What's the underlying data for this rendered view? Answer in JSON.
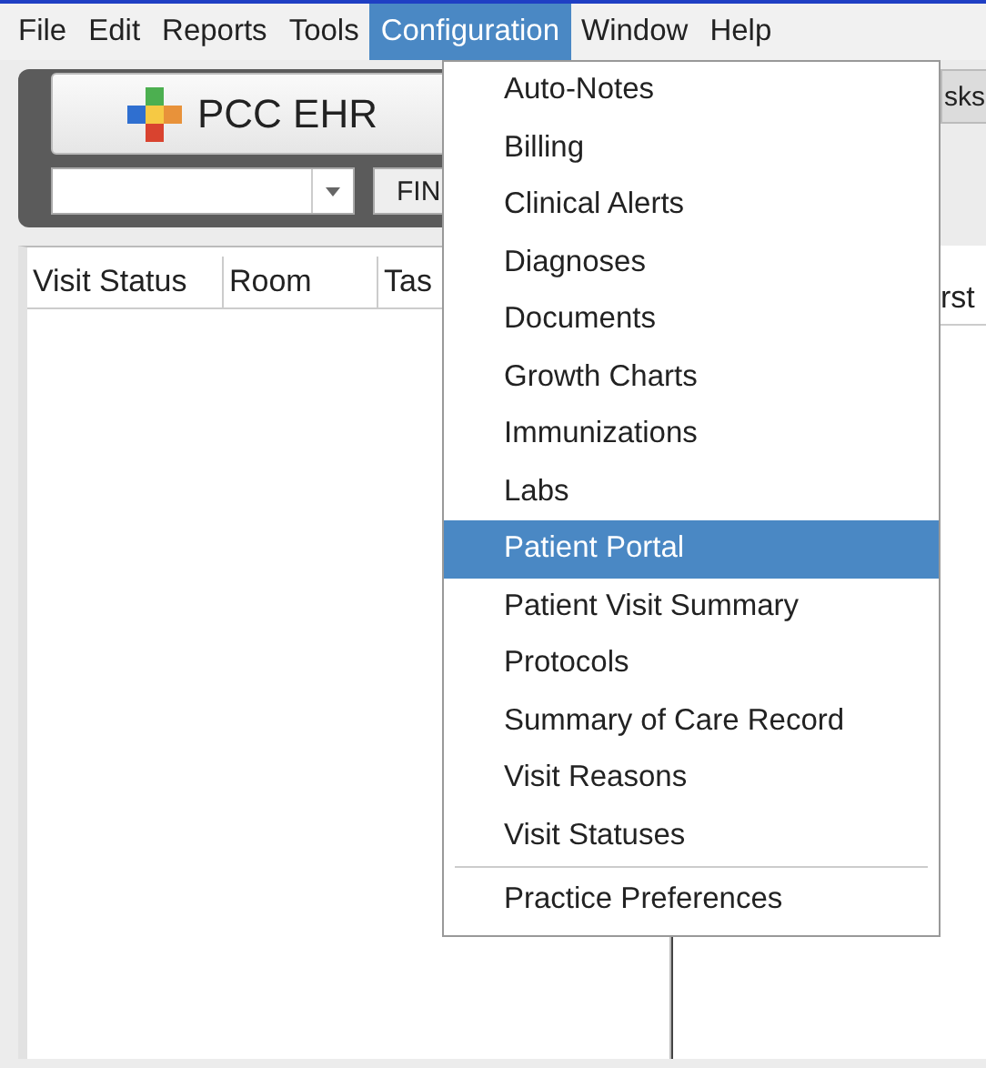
{
  "menu_bar": [
    {
      "label": "File",
      "selected": false
    },
    {
      "label": "Edit",
      "selected": false
    },
    {
      "label": "Reports",
      "selected": false
    },
    {
      "label": "Tools",
      "selected": false
    },
    {
      "label": "Configuration",
      "selected": true
    },
    {
      "label": "Window",
      "selected": false
    },
    {
      "label": "Help",
      "selected": false
    }
  ],
  "toolbar": {
    "app_button": "PCC EHR",
    "find_button": "FIN",
    "tasks_button": "sks"
  },
  "left_table": {
    "columns": [
      "Visit Status",
      "Room",
      "Tas"
    ]
  },
  "right_table": {
    "columns": [
      "rst"
    ]
  },
  "menu": {
    "items": [
      {
        "kind": "item",
        "label": "Auto-Notes",
        "selected": false
      },
      {
        "kind": "item",
        "label": "Billing",
        "selected": false
      },
      {
        "kind": "item",
        "label": "Clinical Alerts",
        "selected": false
      },
      {
        "kind": "item",
        "label": "Diagnoses",
        "selected": false
      },
      {
        "kind": "item",
        "label": "Documents",
        "selected": false
      },
      {
        "kind": "item",
        "label": "Growth Charts",
        "selected": false
      },
      {
        "kind": "item",
        "label": "Immunizations",
        "selected": false
      },
      {
        "kind": "item",
        "label": "Labs",
        "selected": false
      },
      {
        "kind": "item",
        "label": "Patient Portal",
        "selected": true
      },
      {
        "kind": "item",
        "label": "Patient Visit Summary",
        "selected": false
      },
      {
        "kind": "item",
        "label": "Protocols",
        "selected": false
      },
      {
        "kind": "item",
        "label": "Summary of Care Record",
        "selected": false
      },
      {
        "kind": "item",
        "label": "Visit Reasons",
        "selected": false
      },
      {
        "kind": "item",
        "label": "Visit Statuses",
        "selected": false
      },
      {
        "kind": "separator"
      },
      {
        "kind": "item",
        "label": "Practice Preferences",
        "selected": false
      }
    ]
  }
}
